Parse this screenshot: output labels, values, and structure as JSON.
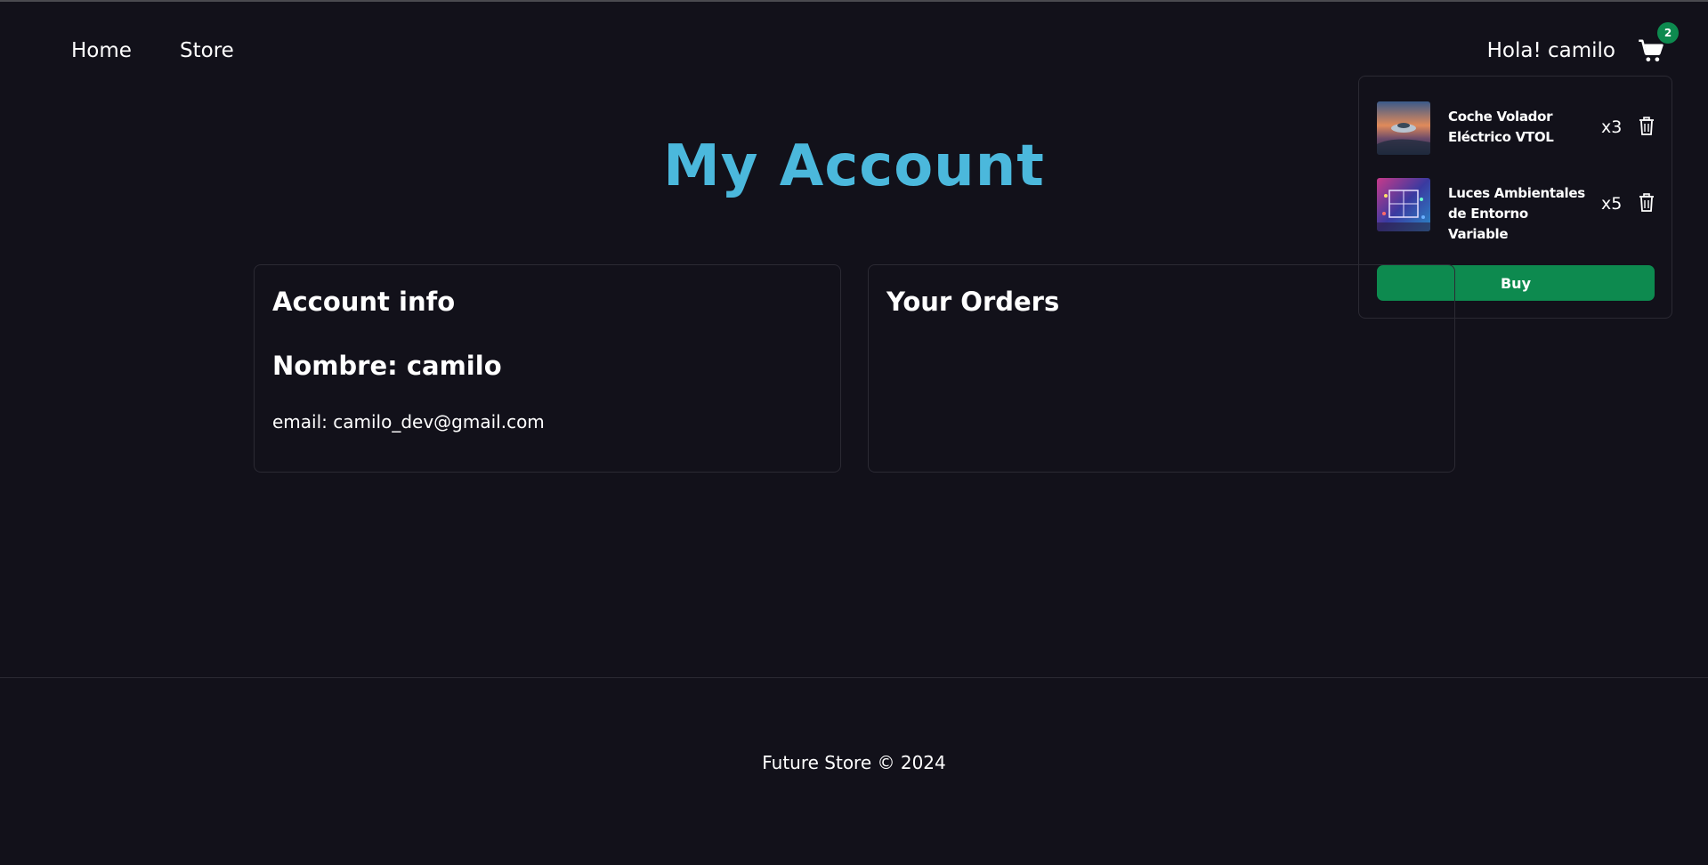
{
  "nav": {
    "home_label": "Home",
    "store_label": "Store",
    "greeting": "Hola! camilo",
    "cart_icon": "shopping-cart-icon",
    "cart_count": "2"
  },
  "cart": {
    "items": [
      {
        "name": "Coche Volador Eléctrico VTOL",
        "qty": "x3",
        "thumb_icon": "flying-car-image"
      },
      {
        "name": "Luces Ambientales de Entorno Variable",
        "qty": "x5",
        "thumb_icon": "ambient-lights-image"
      }
    ],
    "buy_label": "Buy",
    "delete_icon": "trash-icon"
  },
  "page": {
    "title": "My Account"
  },
  "account": {
    "heading": "Account info",
    "name_line": "Nombre: camilo",
    "email_line": "email: camilo_dev@gmail.com"
  },
  "orders": {
    "heading": "Your Orders"
  },
  "footer": {
    "text": "Future Store © 2024"
  },
  "colors": {
    "background": "#12111a",
    "accent_title": "#4bb8dc",
    "buy_green": "#0d8a4f",
    "border": "#2b2a33"
  }
}
